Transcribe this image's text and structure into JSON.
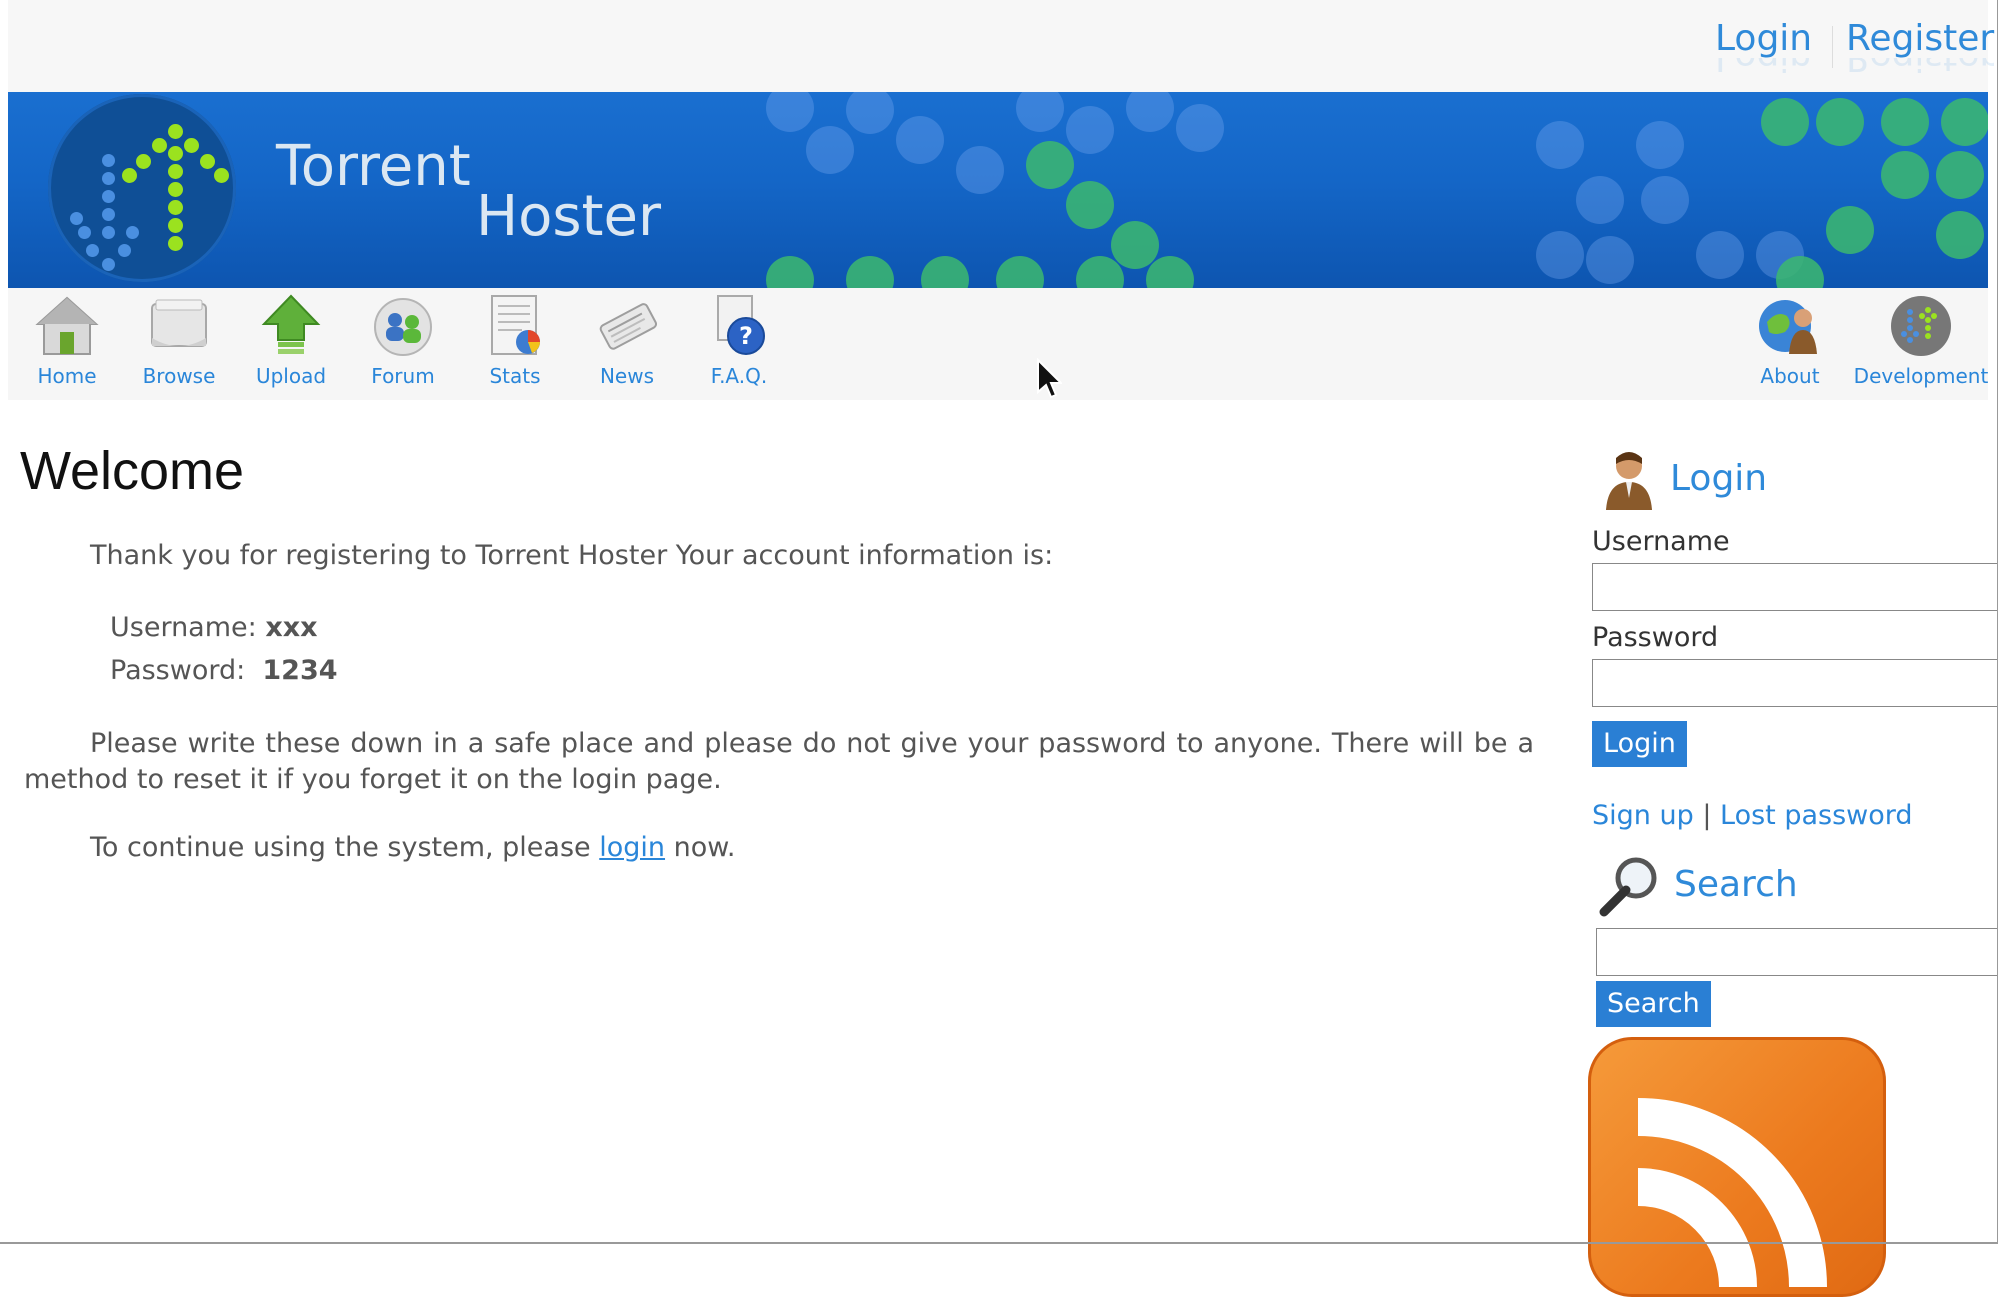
{
  "top_links": {
    "login": "Login",
    "register": "Register"
  },
  "banner": {
    "title_line1": "Torrent",
    "title_line2": "Hoster"
  },
  "nav": {
    "items": [
      {
        "label": "Home",
        "icon": "home-icon"
      },
      {
        "label": "Browse",
        "icon": "browse-icon"
      },
      {
        "label": "Upload",
        "icon": "upload-icon"
      },
      {
        "label": "Forum",
        "icon": "forum-icon"
      },
      {
        "label": "Stats",
        "icon": "stats-icon"
      },
      {
        "label": "News",
        "icon": "news-icon"
      },
      {
        "label": "F.A.Q.",
        "icon": "faq-icon"
      },
      {
        "label": "About",
        "icon": "about-icon"
      },
      {
        "label": "Development",
        "icon": "development-icon"
      }
    ]
  },
  "main": {
    "title": "Welcome",
    "intro": "Thank you for registering to Torrent Hoster Your account information is:",
    "username_label": "Username:",
    "username_value": "xxx",
    "password_label": "Password:",
    "password_value": "1234",
    "note": "Please write these down in a safe place and please do not give your password to anyone. There will be a method to reset it if you forget it on the login page.",
    "continue_prefix": "To continue using the system, please",
    "continue_link": "login",
    "continue_suffix": "now."
  },
  "sidebar": {
    "login_heading": "Login",
    "username_label": "Username",
    "password_label": "Password",
    "login_button": "Login",
    "signup_link": "Sign up",
    "separator": "|",
    "lost_password_link": "Lost password",
    "search_heading": "Search",
    "search_button": "Search"
  },
  "colors": {
    "link": "#2a86d9",
    "banner_blue": "#1466c7",
    "button_blue": "#2a7fd4",
    "rss_orange": "#ec7a1e",
    "logo_green": "#9be21f"
  }
}
